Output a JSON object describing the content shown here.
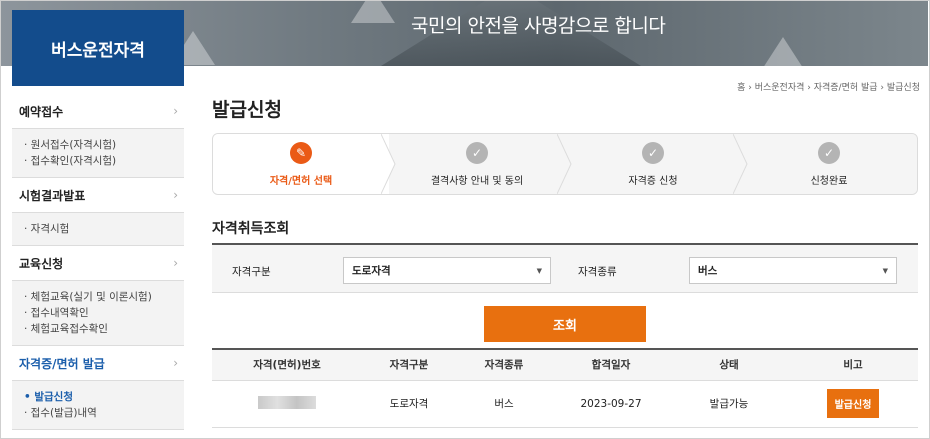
{
  "banner": {
    "slogan": "국민의 안전을 사명감으로 합니다"
  },
  "logo": {
    "title": "버스운전자격"
  },
  "sidebar": {
    "sections": [
      {
        "label": "예약접수",
        "items": [
          "· 원서접수(자격시험)",
          "· 접수확인(자격시험)"
        ]
      },
      {
        "label": "시험결과발표",
        "items": [
          "· 자격시험"
        ]
      },
      {
        "label": "교육신청",
        "items": [
          "· 체험교육(실기 및 이론시험)",
          "· 접수내역확인",
          "· 체험교육접수확인"
        ]
      },
      {
        "label": "자격증/면허 발급",
        "items": [
          "• 발급신청",
          "· 접수(발급)내역"
        ]
      }
    ],
    "chevron": "›"
  },
  "breadcrumb": "홈 › 버스운전자격 › 자격증/면허 발급 › 발급신청",
  "page_title": "발급신청",
  "steps": [
    {
      "label": "자격/면허 선택",
      "icon": "pencil-icon",
      "glyph": "✎"
    },
    {
      "label": "결격사항 안내 및 동의",
      "icon": "check-icon",
      "glyph": "✓"
    },
    {
      "label": "자격증 신청",
      "icon": "check-icon",
      "glyph": "✓"
    },
    {
      "label": "신청완료",
      "icon": "check-icon",
      "glyph": "✓"
    }
  ],
  "section_title": "자격취득조회",
  "search": {
    "type_label": "자격구분",
    "type_value": "도로자격",
    "kind_label": "자격종류",
    "kind_value": "버스",
    "button": "조회"
  },
  "table": {
    "headers": [
      "자격(면허)번호",
      "자격구분",
      "자격종류",
      "합격일자",
      "상태",
      "비고"
    ],
    "rows": [
      {
        "number": "",
        "type": "도로자격",
        "kind": "버스",
        "date": "2023-09-27",
        "status": "발급가능",
        "action": "발급신청"
      }
    ]
  },
  "colors": {
    "brand": "#134c8c",
    "accent": "#e8700f",
    "active_step": "#ea5a16",
    "link": "#1b5eab"
  }
}
